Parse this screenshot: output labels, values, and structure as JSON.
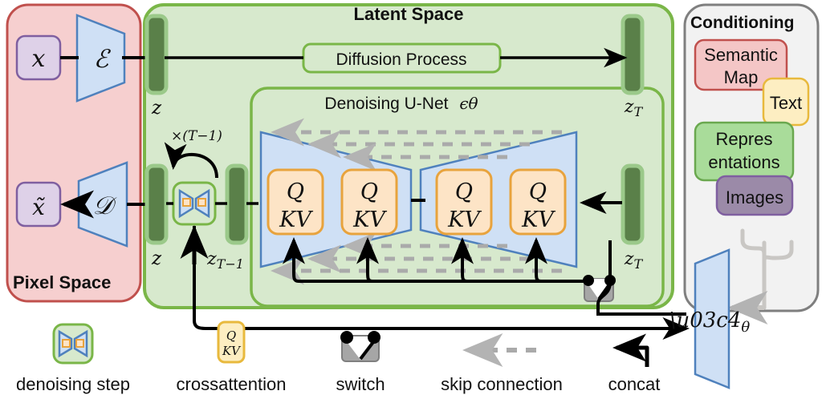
{
  "figure": {
    "name": "latent-diffusion-model-architecture",
    "colors": {
      "pixel_space_fill": "#f6cfcf",
      "pixel_space_stroke": "#c0504d",
      "latent_space_fill": "#d7e9cd",
      "latent_space_stroke": "#7ab648",
      "unet_fill": "#d7e9cd",
      "unet_stroke": "#7ab648",
      "conditioning_fill": "#f2f2f2",
      "conditioning_stroke": "#7f7f7f",
      "latent_bar_fill": "#5a8049",
      "latent_bar_outline": "#9bc98a",
      "trapezoid_fill": "#cfe0f5",
      "trapezoid_stroke": "#4f81bd",
      "attention_fill": "#fde4c6",
      "attention_stroke": "#e8a33d",
      "variable_box_fill": "#ded1e8",
      "variable_box_stroke": "#7f5fa0",
      "text_box_fill": "#fdeec2",
      "text_box_stroke": "#e8b93d",
      "semantic_map_fill": "#f4c6c6",
      "semantic_map_stroke": "#c0504d",
      "representations_fill": "#a9dc9a",
      "representations_stroke": "#6aa84f",
      "images_fill": "#9b8aa8",
      "images_stroke": "#7f5fa0",
      "skip_gray": "#aaaaaa",
      "switch_gray": "#a6a6a6",
      "wire_black": "#000000"
    },
    "panels": {
      "pixel_space": {
        "label": "Pixel Space"
      },
      "latent_space": {
        "label": "Latent Space"
      },
      "unet": {
        "label": "Denoising U-Net",
        "symbol": "ϵθ"
      },
      "conditioning": {
        "label": "Conditioning"
      }
    },
    "pixel_space_nodes": {
      "input": "x",
      "encoder": "ℰ",
      "decoder": "𝒟",
      "output": "x̃"
    },
    "latent_nodes": {
      "z_top": "z",
      "z_bottom": "z",
      "z_T_top": "z_T",
      "z_T_bottom": "z_T",
      "z_T_minus_1": "z_{T-1}",
      "diffusion_process": "Diffusion Process",
      "loop_count": "×(T−1)"
    },
    "attention_blocks": [
      {
        "q": "Q",
        "kv": "KV"
      },
      {
        "q": "Q",
        "kv": "KV"
      },
      {
        "q": "Q",
        "kv": "KV"
      },
      {
        "q": "Q",
        "kv": "KV"
      }
    ],
    "conditioning_items": [
      {
        "label_line1": "Semantic",
        "label_line2": "Map",
        "name": "semantic-map"
      },
      {
        "label_line1": "Text",
        "label_line2": "",
        "name": "text"
      },
      {
        "label_line1": "Repres",
        "label_line2": "entations",
        "name": "representations"
      },
      {
        "label_line1": "Images",
        "label_line2": "",
        "name": "images"
      }
    ],
    "conditioning_encoder": "τθ",
    "legend": [
      {
        "name": "denoising-step",
        "label": "denoising step"
      },
      {
        "name": "crossattention",
        "label": "crossattention",
        "q": "Q",
        "kv": "KV"
      },
      {
        "name": "switch",
        "label": "switch"
      },
      {
        "name": "skip-connection",
        "label": "skip connection"
      },
      {
        "name": "concat",
        "label": "concat"
      }
    ]
  }
}
